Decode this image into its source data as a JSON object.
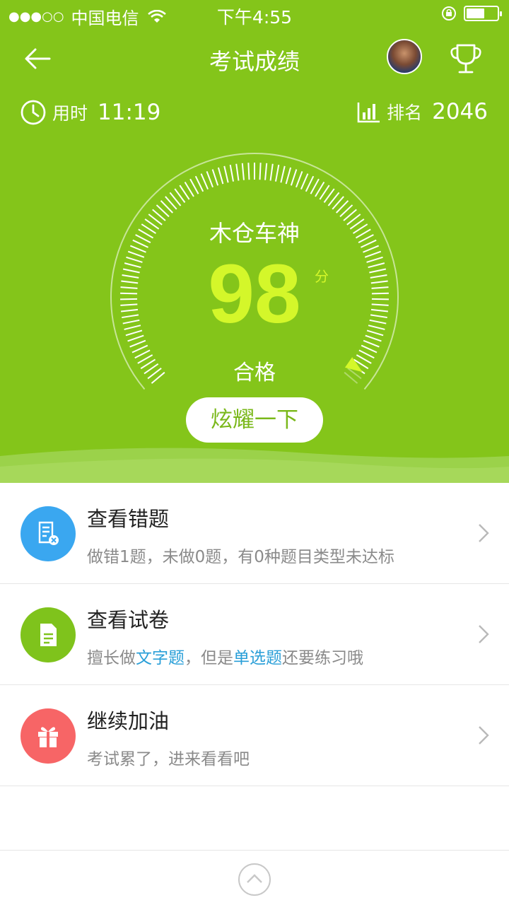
{
  "status_bar": {
    "signal": "●●●○○",
    "carrier": "中国电信",
    "time": "下午4:55",
    "battery_level": 0.55
  },
  "nav": {
    "title": "考试成绩",
    "icons": [
      "back-arrow-icon",
      "avatar",
      "trophy-icon"
    ]
  },
  "stats": {
    "time_label": "用时",
    "time_value": "11:19",
    "rank_label": "排名",
    "rank_value": "2046"
  },
  "result": {
    "title_name": "木仓车神",
    "score": "98",
    "score_unit": "分",
    "status": "合格",
    "score_fraction": 0.98
  },
  "share_button": "炫耀一下",
  "list": [
    {
      "title": "查看错题",
      "desc": "做错1题，未做0题，有0种题目类型未达标",
      "icon": "wrong-questions-icon",
      "color": "#3aa7f0"
    },
    {
      "title": "查看试卷",
      "desc_prefix": "擅长做",
      "desc_hl1": "文字题",
      "desc_mid": "，但是",
      "desc_hl2": "单选题",
      "desc_suffix": "还要练习哦",
      "icon": "paper-icon",
      "color": "#7fc31c"
    },
    {
      "title": "继续加油",
      "desc": "考试累了，进来看看吧",
      "icon": "gift-icon",
      "color": "#f76566"
    }
  ],
  "colors": {
    "primary_green": "#84c51a",
    "score_yellow": "#d4f72a",
    "link_blue": "#2a9fd8"
  }
}
